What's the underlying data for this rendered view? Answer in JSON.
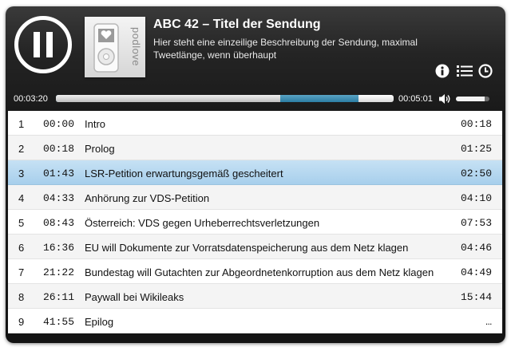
{
  "episode": {
    "title": "ABC 42 – Titel der Sendung",
    "subtitle": "Hier steht eine einzeilige Beschreibung der Sendung, maximal Tweetlänge, wenn überhaupt",
    "cover_text": "podlove"
  },
  "controls": {
    "play_state": "pause-icon",
    "icons": [
      "info-icon",
      "chapters-list-icon",
      "clock-icon"
    ]
  },
  "progress": {
    "current_time": "00:03:20",
    "total_time": "00:05:01",
    "played_fraction": 0.665,
    "buffered_fraction": 0.895
  },
  "volume": {
    "icon": "speaker-icon",
    "level_fraction": 0.85
  },
  "colors": {
    "player_bg": "#1a1a1a",
    "accent_blue": "#2c7ea3",
    "active_row": "#b6d7ef"
  },
  "chapters": [
    {
      "num": "1",
      "start": "00:00",
      "title": "Intro",
      "duration": "00:18",
      "active": false
    },
    {
      "num": "2",
      "start": "00:18",
      "title": "Prolog",
      "duration": "01:25",
      "active": false
    },
    {
      "num": "3",
      "start": "01:43",
      "title": "LSR-Petition erwartungsgemäß gescheitert",
      "duration": "02:50",
      "active": true
    },
    {
      "num": "4",
      "start": "04:33",
      "title": "Anhörung zur VDS-Petition",
      "duration": "04:10",
      "active": false
    },
    {
      "num": "5",
      "start": "08:43",
      "title": "Österreich: VDS gegen Urheberrechtsverletzungen",
      "duration": "07:53",
      "active": false
    },
    {
      "num": "6",
      "start": "16:36",
      "title": "EU will Dokumente zur Vorratsdatenspeicherung aus dem Netz klagen",
      "duration": "04:46",
      "active": false
    },
    {
      "num": "7",
      "start": "21:22",
      "title": "Bundestag will Gutachten zur Abgeordnetenkorruption aus dem Netz klagen",
      "duration": "04:49",
      "active": false
    },
    {
      "num": "8",
      "start": "26:11",
      "title": "Paywall bei Wikileaks",
      "duration": "15:44",
      "active": false
    },
    {
      "num": "9",
      "start": "41:55",
      "title": "Epilog",
      "duration": "…",
      "active": false
    }
  ]
}
